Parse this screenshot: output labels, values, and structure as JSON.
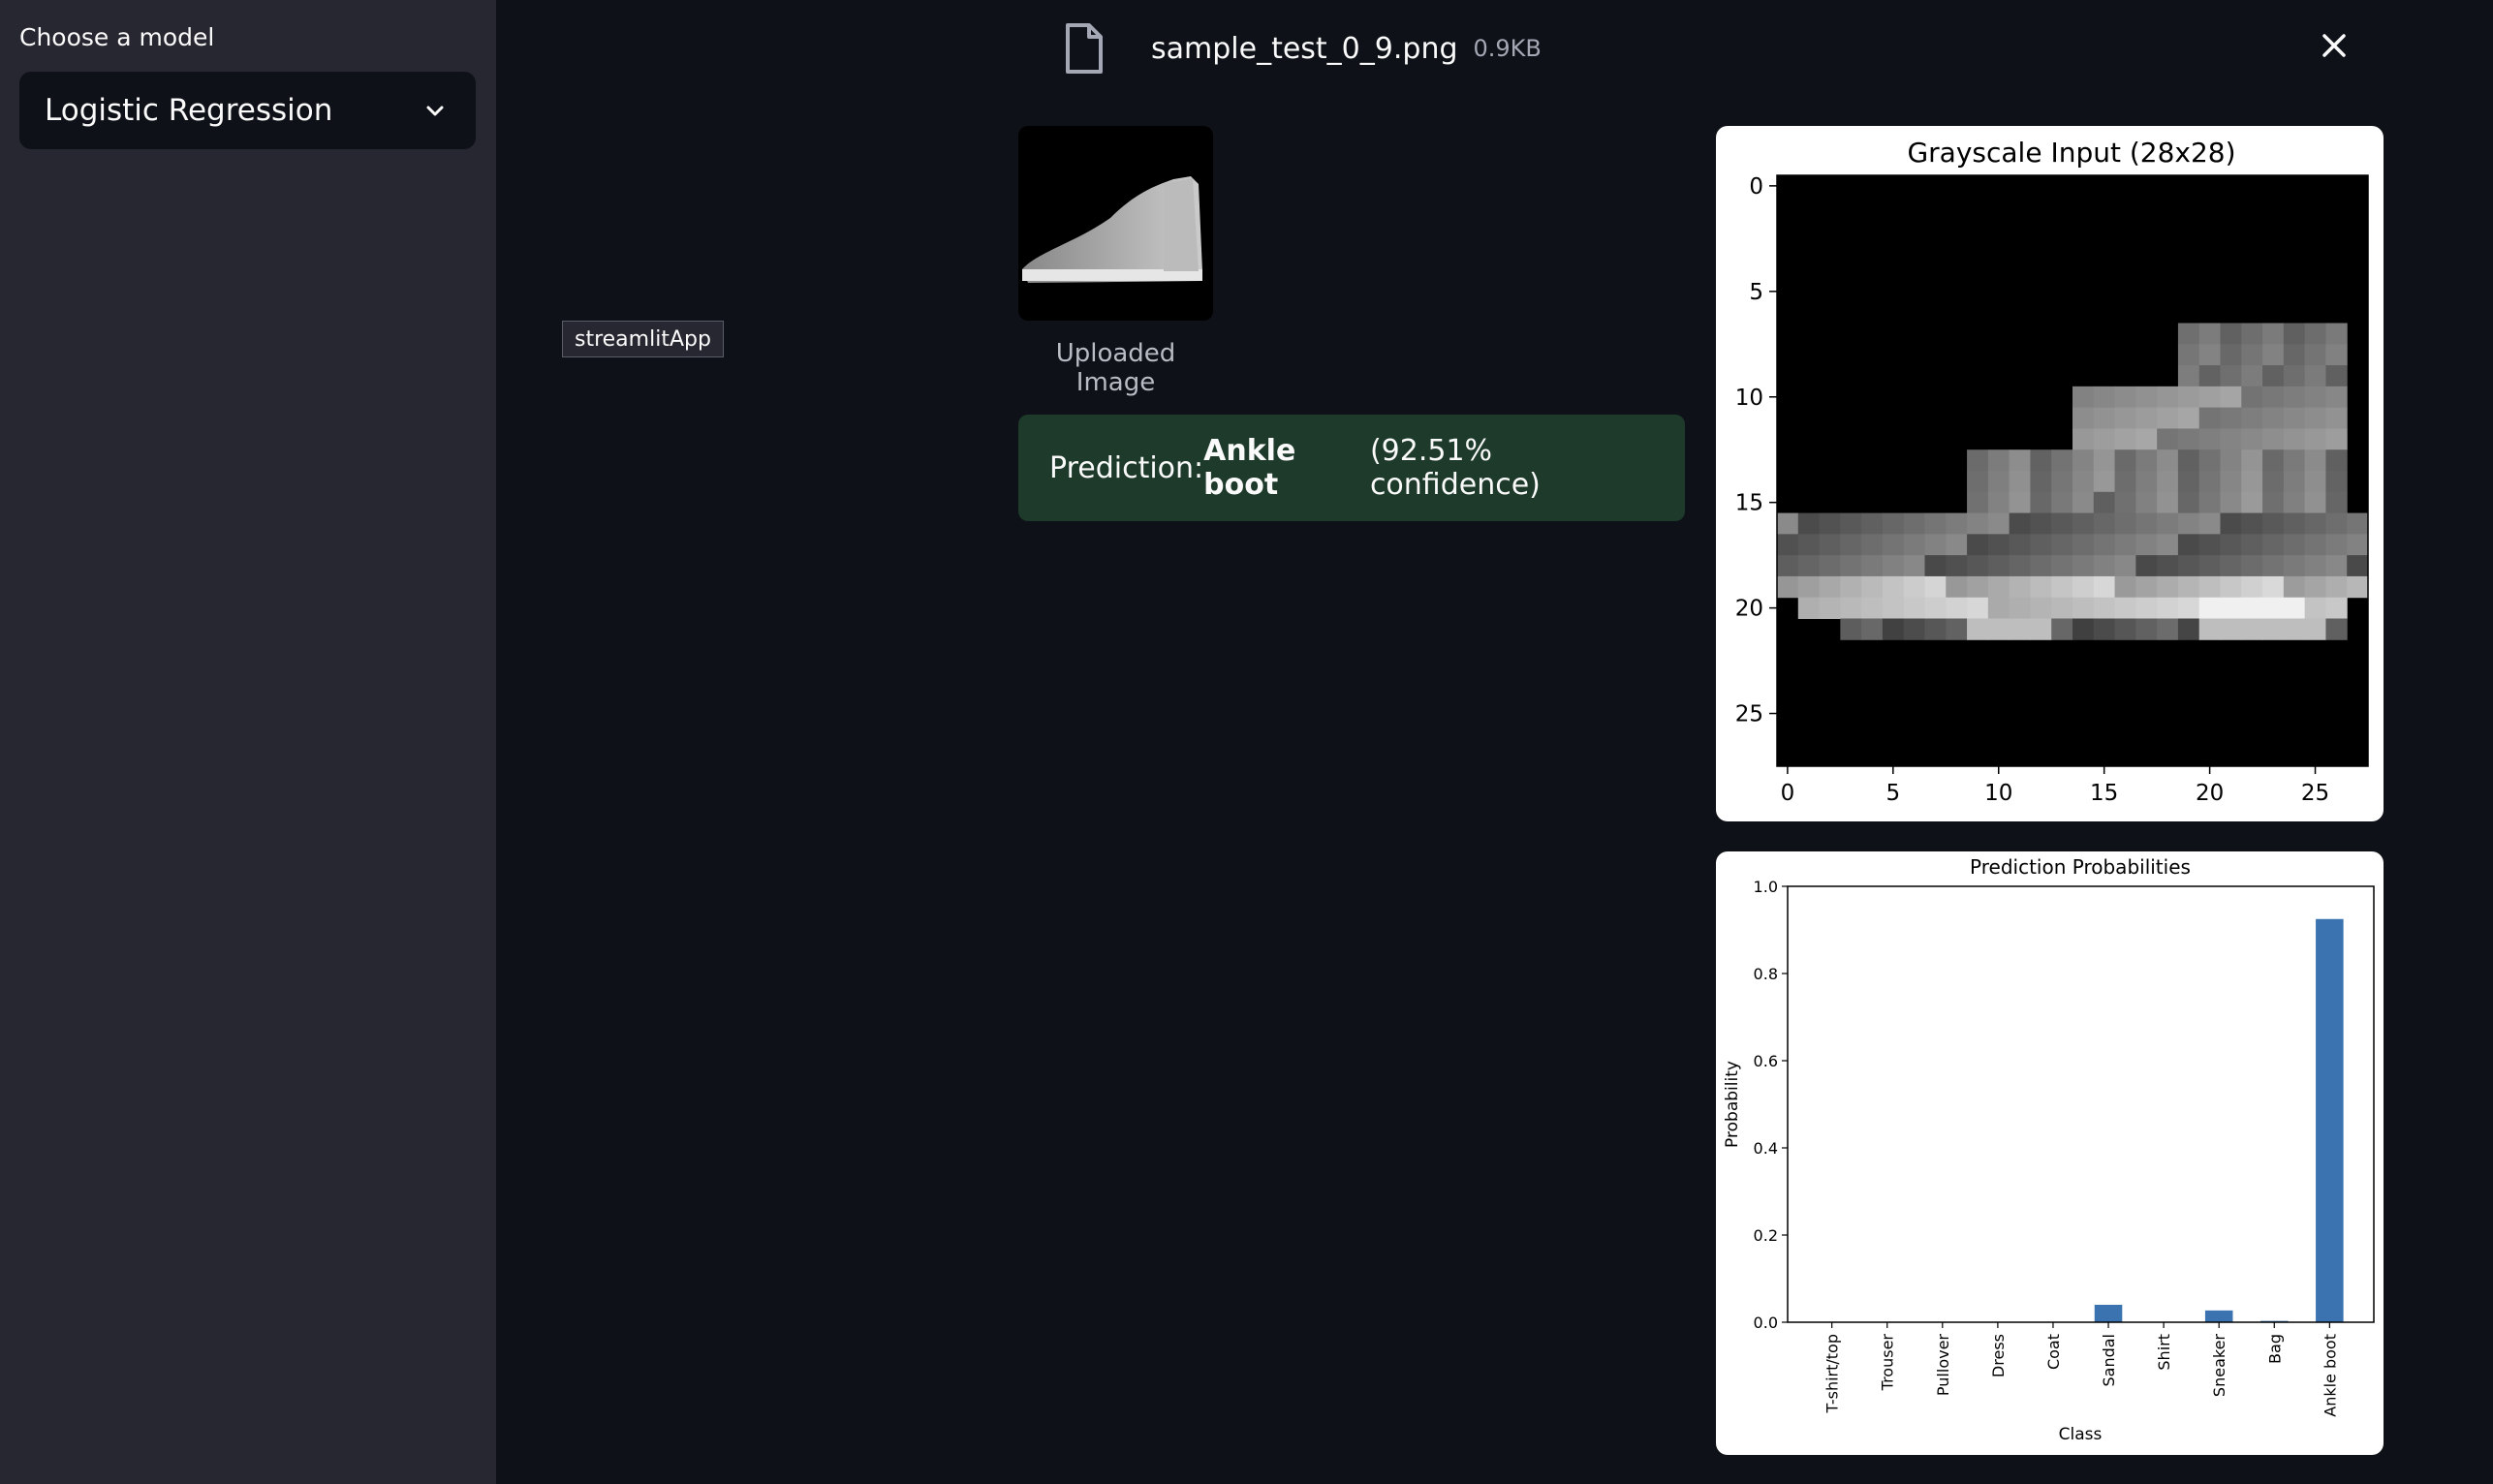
{
  "sidebar": {
    "label": "Choose a model",
    "selected_model": "Logistic Regression"
  },
  "file": {
    "name": "sample_test_0_9.png",
    "size": "0.9KB"
  },
  "tag": "streamlitApp",
  "uploaded_caption": "Uploaded Image",
  "prediction": {
    "prefix": "Prediction: ",
    "label": "Ankle boot",
    "suffix": " (92.51% confidence)"
  },
  "icons": {
    "file": "file-icon",
    "close": "close-icon",
    "chevron": "chevron-down-icon"
  },
  "colors": {
    "sidebar_bg": "#262730",
    "main_bg": "#0e1117",
    "prediction_bg": "#1d3a2b",
    "bar_color": "#3b72b0"
  },
  "chart_data": [
    {
      "type": "heatmap",
      "title": "Grayscale Input (28x28)",
      "xlim": [
        0,
        27
      ],
      "ylim": [
        0,
        27
      ],
      "x_ticks": [
        "0",
        "5",
        "10",
        "15",
        "20",
        "25"
      ],
      "y_ticks": [
        "0",
        "5",
        "10",
        "15",
        "20",
        "25"
      ]
    },
    {
      "type": "bar",
      "title": "Prediction Probabilities",
      "xlabel": "Class",
      "ylabel": "Probability",
      "ylim": [
        0,
        1.0
      ],
      "y_ticks": [
        "0.0",
        "0.2",
        "0.4",
        "0.6",
        "0.8",
        "1.0"
      ],
      "categories": [
        "T-shirt/top",
        "Trouser",
        "Pullover",
        "Dress",
        "Coat",
        "Sandal",
        "Shirt",
        "Sneaker",
        "Bag",
        "Ankle boot"
      ],
      "values": [
        0.0,
        0.0,
        0.0,
        0.0,
        0.0,
        0.04,
        0.0,
        0.027,
        0.003,
        0.925
      ]
    }
  ]
}
